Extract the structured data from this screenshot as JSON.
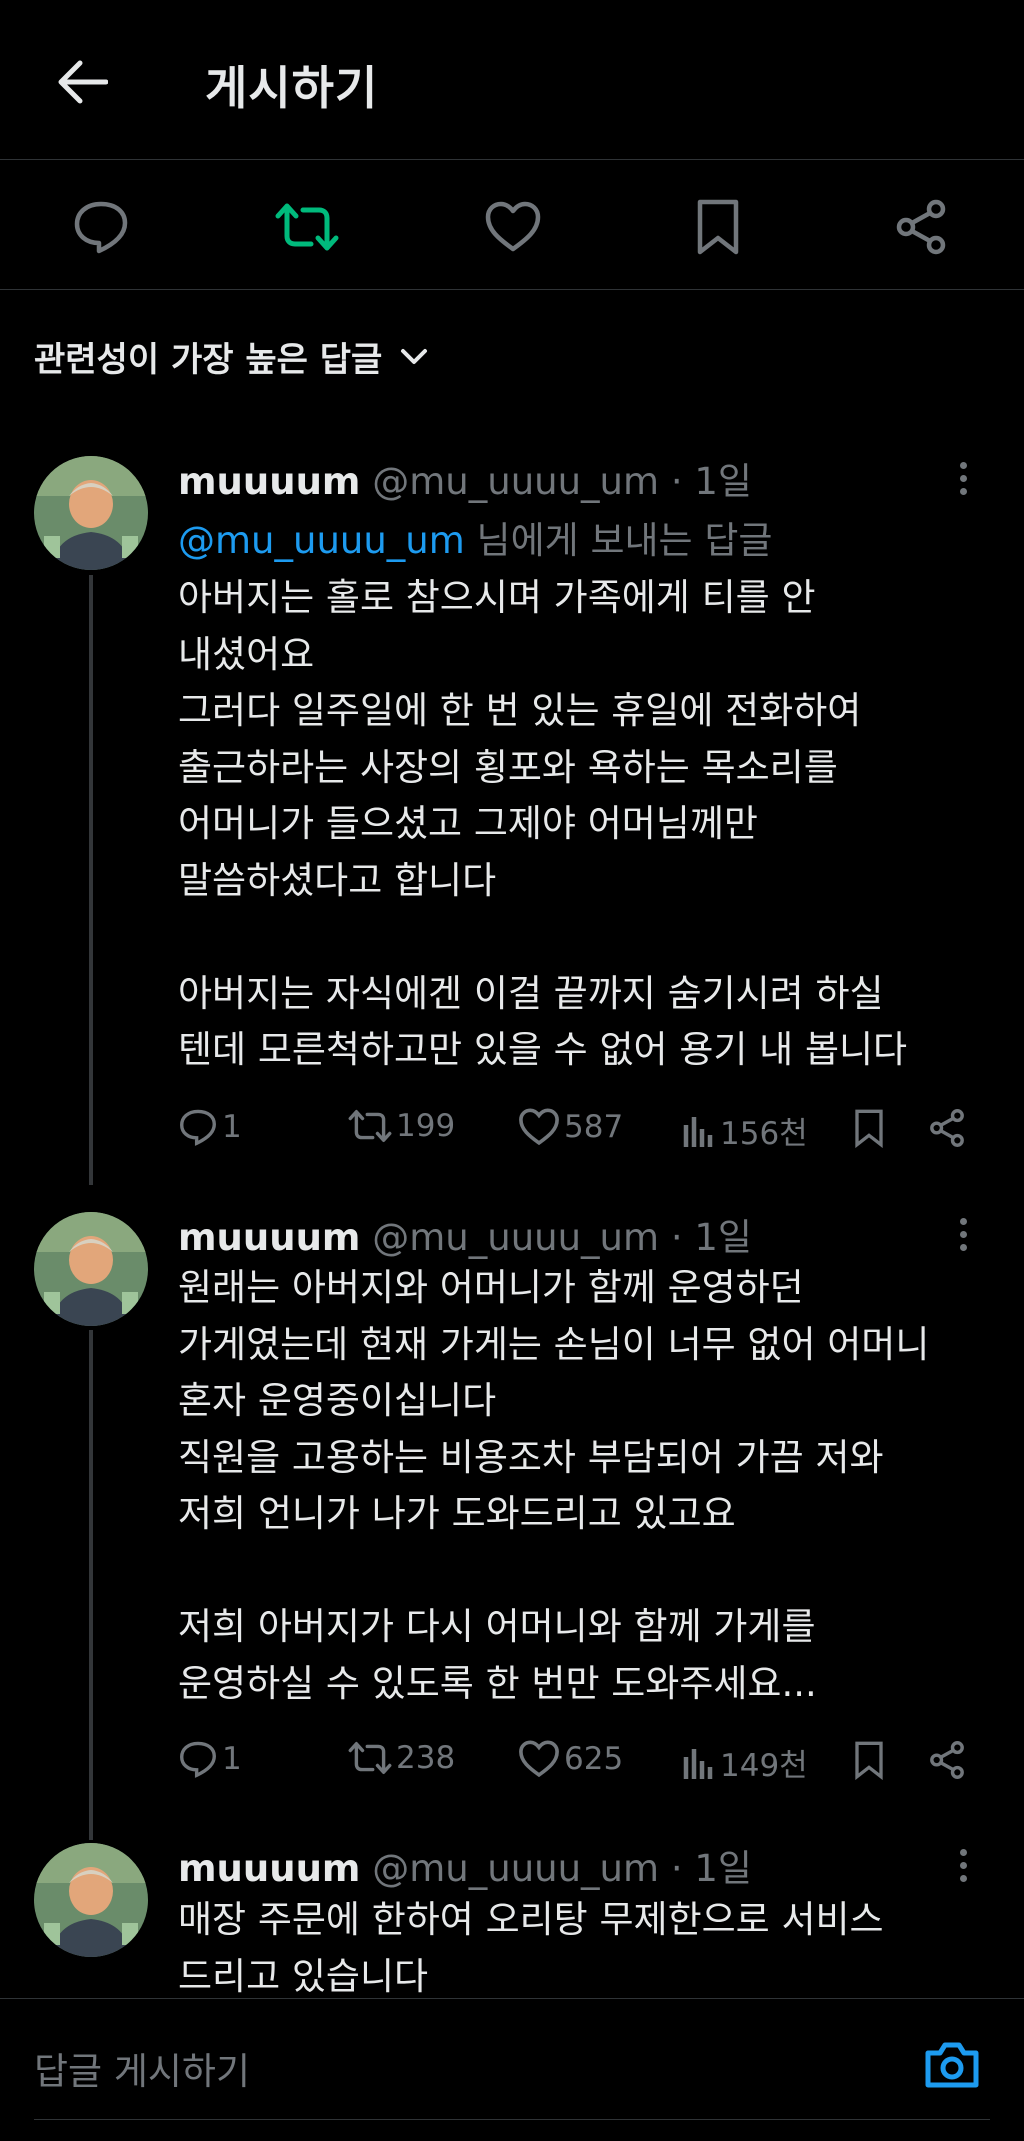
{
  "header": {
    "title": "게시하기"
  },
  "action_bar": {
    "icons": [
      "reply-icon",
      "retweet-icon",
      "like-icon",
      "bookmark-icon",
      "share-icon"
    ],
    "retweet_active_color": "#00ba7c"
  },
  "sort": {
    "label": "관련성이 가장 높은 답글"
  },
  "tweets": [
    {
      "name": "muuuum",
      "handle": "@mu_uuuu_um",
      "dot": "·",
      "time": "1일",
      "reply_mention": "@mu_uuuu_um",
      "reply_suffix": " 님에게 보내는 답글",
      "lines": [
        "아버지는 홀로 참으시며 가족에게 티를 안",
        "내셨어요",
        "그러다 일주일에 한 번 있는 휴일에 전화하여",
        "출근하라는 사장의 횡포와 욕하는 목소리를",
        "어머니가 들으셨고 그제야 어머님께만",
        "말씀하셨다고 합니다",
        "",
        "아버지는 자식에겐 이걸 끝까지 숨기시려 하실",
        "텐데 모른척하고만 있을 수 없어 용기 내 봅니다"
      ],
      "replies": "1",
      "retweets": "199",
      "likes": "587",
      "views": "156천"
    },
    {
      "name": "muuuum",
      "handle": "@mu_uuuu_um",
      "dot": "·",
      "time": "1일",
      "lines": [
        "원래는 아버지와 어머니가 함께 운영하던",
        "가게였는데 현재 가게는 손님이 너무 없어 어머니",
        "혼자 운영중이십니다",
        "직원을 고용하는 비용조차 부담되어 가끔 저와",
        "저희 언니가 나가 도와드리고 있고요",
        "",
        "저희 아버지가 다시 어머니와 함께 가게를",
        "운영하실 수 있도록 한 번만 도와주세요..."
      ],
      "replies": "1",
      "retweets": "238",
      "likes": "625",
      "views": "149천"
    },
    {
      "name": "muuuum",
      "handle": "@mu_uuuu_um",
      "dot": "·",
      "time": "1일",
      "lines": [
        "매장 주문에 한하여 오리탕 무제한으로 서비스",
        "드리고 있습니다"
      ]
    }
  ],
  "composer": {
    "placeholder": "답글 게시하기",
    "camera_icon": "camera-icon",
    "camera_color": "#1d9bf0"
  }
}
